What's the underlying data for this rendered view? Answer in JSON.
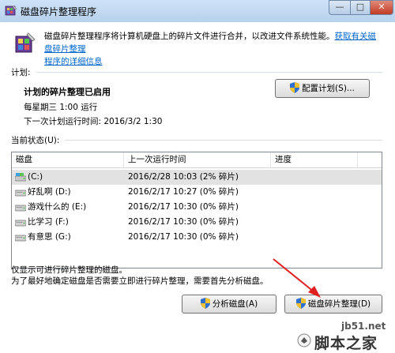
{
  "window": {
    "title": "磁盘碎片整理程序",
    "controls": {
      "minimize": "—",
      "maximize": "□",
      "close": "✕"
    }
  },
  "intro": {
    "text": "磁盘碎片整理程序将计算机硬盘上的碎片文件进行合并，以改进文件系统性能。",
    "link_line1": "获取有关磁盘碎片整理",
    "link_line2": "程序的详细信息"
  },
  "schedule": {
    "group_label": "计划:",
    "heading": "计划的碎片整理已启用",
    "run_time": "每星期三 1:00 运行",
    "next_run": "下一次计划运行时间: 2016/3/2 1:30",
    "configure_button": "配置计划(S)..."
  },
  "status": {
    "group_label": "当前状态(U):",
    "columns": [
      "磁盘",
      "上一次运行时间",
      "进度"
    ],
    "rows": [
      {
        "disk": "(C:)",
        "last_run": "2016/2/28 10:03 (2% 碎片)",
        "progress": "",
        "icon": "system-drive-icon"
      },
      {
        "disk": "好乱啊 (D:)",
        "last_run": "2016/2/17 10:27 (0% 碎片)",
        "progress": "",
        "icon": "drive-icon"
      },
      {
        "disk": "游戏什么的 (E:)",
        "last_run": "2016/2/17 10:30 (0% 碎片)",
        "progress": "",
        "icon": "drive-icon"
      },
      {
        "disk": "比学习 (F:)",
        "last_run": "2016/2/17 10:30 (0% 碎片)",
        "progress": "",
        "icon": "drive-icon"
      },
      {
        "disk": "有意思 (G:)",
        "last_run": "2016/2/17 10:30 (0% 碎片)",
        "progress": "",
        "icon": "drive-icon"
      }
    ]
  },
  "footer": {
    "note_line1": "仅显示可进行碎片整理的磁盘。",
    "note_line2": "为了最好地确定磁盘是否需要立即进行碎片整理，需要首先分析磁盘。",
    "analyze_button": "分析磁盘(A)",
    "defrag_button": "磁盘碎片整理(D)"
  },
  "watermark": {
    "site": "jb51.net",
    "brand": "脚本之家"
  },
  "colors": {
    "link": "#0066cc",
    "annotation_arrow": "#e02020",
    "selection": "#e2e2e2"
  }
}
